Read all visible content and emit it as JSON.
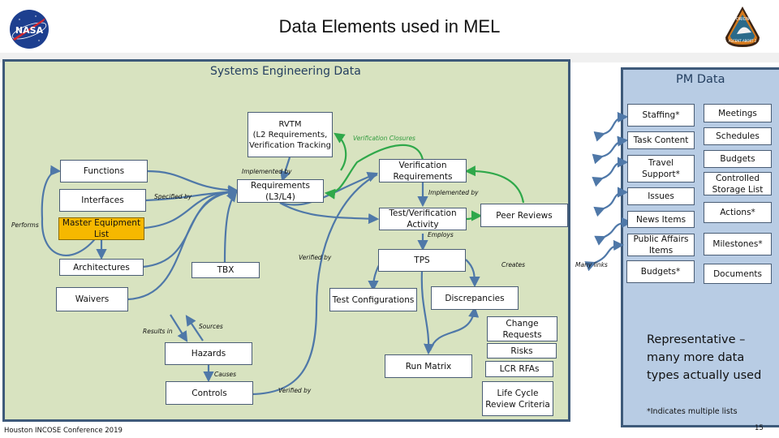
{
  "header": {
    "title": "Data Elements used in MEL",
    "left_logo": "nasa-meatball-logo",
    "right_logo": "orion-ascent-abort-2-patch"
  },
  "colors": {
    "se_panel_bg": "#d8e3c0",
    "pm_panel_bg": "#b8cce4",
    "panel_border": "#3e5a7a",
    "connector_blue": "#4f78a8",
    "connector_green": "#2fa84a",
    "mel_highlight": "#f6b800"
  },
  "se_panel": {
    "title": "Systems Engineering Data",
    "boxes": {
      "rvtm": "RVTM\n(L2 Requirements, Verification Tracking",
      "functions": "Functions",
      "interfaces": "Interfaces",
      "mel": "Master Equipment List",
      "architectures": "Architectures",
      "waivers": "Waivers",
      "requirements": "Requirements (L3/L4)",
      "tbx": "TBX",
      "verification_requirements": "Verification Requirements",
      "test_verification_activity": "Test/Verification Activity",
      "peer_reviews": "Peer Reviews",
      "tps": "TPS",
      "test_configurations": "Test Configurations",
      "discrepancies": "Discrepancies",
      "hazards": "Hazards",
      "controls": "Controls",
      "run_matrix": "Run Matrix",
      "change_requests": "Change Requests",
      "risks": "Risks",
      "lcr_rfas": "LCR RFAs",
      "life_cycle_review_criteria": "Life Cycle Review Criteria"
    },
    "link_labels": {
      "performs": "Performs",
      "specified_by": "Specified by",
      "implemented_by_top": "Implemented by",
      "verification_closures": "Verification Closures",
      "implemented_by_mid": "Implemented by",
      "employs": "Employs",
      "verified_by_top": "Verified by",
      "creates": "Creates",
      "results_in": "Results in",
      "sources": "Sources",
      "causes": "Causes",
      "verified_by_bottom": "Verified by"
    }
  },
  "between_panels": {
    "many_links": "Many links"
  },
  "pm_panel": {
    "title": "PM Data",
    "left_column": [
      "Staffing*",
      "Task Content",
      "Travel Support*",
      "Issues",
      "News Items",
      "Public Affairs Items",
      "Budgets*"
    ],
    "right_column": [
      "Meetings",
      "Schedules",
      "Budgets",
      "Controlled Storage List",
      "Actions*",
      "Milestones*",
      "Documents"
    ],
    "representative_note": "Representative – many more data types actually used",
    "footnote": "*Indicates multiple lists"
  },
  "footer": {
    "conference": "Houston INCOSE Conference 2019",
    "page_number": "15"
  }
}
